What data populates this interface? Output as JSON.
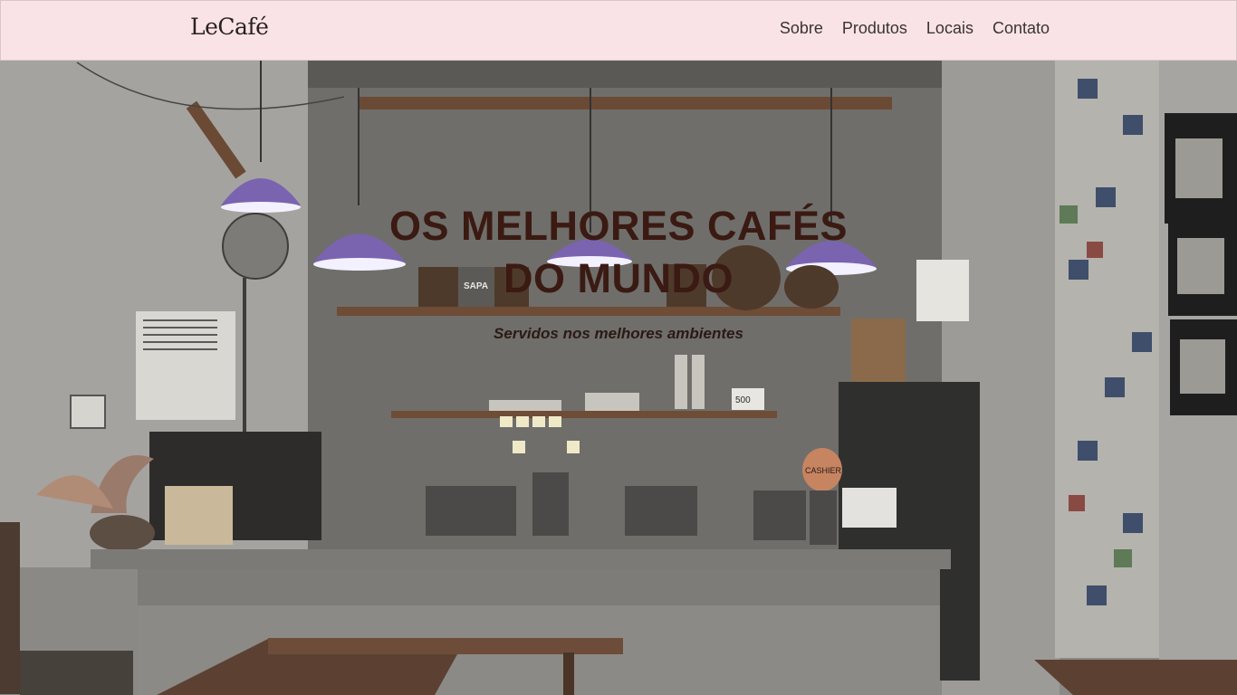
{
  "brand": {
    "name": "LeCafé"
  },
  "nav": {
    "items": [
      {
        "label": "Sobre"
      },
      {
        "label": "Produtos"
      },
      {
        "label": "Locais"
      },
      {
        "label": "Contato"
      }
    ]
  },
  "hero": {
    "title": "OS MELHORES CAFÉS DO MUNDO",
    "subtitle": "Servidos nos melhores ambientes",
    "image_labels": {
      "book_title": "SAPA",
      "sign_price": "500",
      "cashier_jar": "CASHIER"
    }
  },
  "colors": {
    "navbar_bg": "#f9e3e6",
    "title": "#3a1a12",
    "lamp": "#7a64b0"
  }
}
